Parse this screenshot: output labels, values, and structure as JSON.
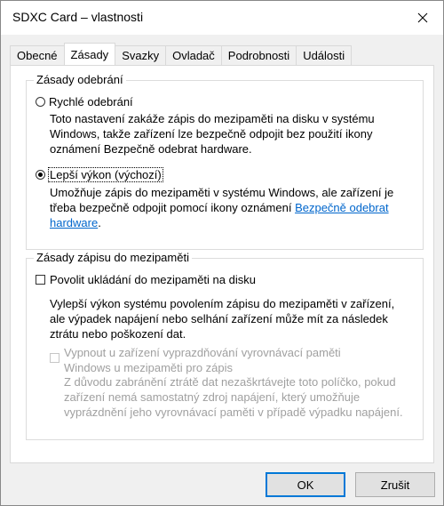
{
  "window": {
    "title": "SDXC Card – vlastnosti",
    "close_icon": "close-icon"
  },
  "tabs": [
    {
      "label": "Obecné"
    },
    {
      "label": "Zásady"
    },
    {
      "label": "Svazky"
    },
    {
      "label": "Ovladač"
    },
    {
      "label": "Podrobnosti"
    },
    {
      "label": "Události"
    }
  ],
  "active_tab": "Zásady",
  "removal_policy": {
    "legend": "Zásady odebrání",
    "quick": {
      "label": "Rychlé odebrání",
      "checked": false,
      "desc": "Toto nastavení zakáže zápis do mezipaměti na disku v systému Windows, takže zařízení lze bezpečně odpojit bez použití ikony oznámení Bezpečně odebrat hardware."
    },
    "performance": {
      "label": "Lepší výkon (výchozí)",
      "checked": true,
      "desc": "Umožňuje zápis do mezipaměti v systému Windows, ale zařízení je třeba bezpečně odpojit pomocí ikony oznámení ",
      "link": "Bezpečně odebrat hardware",
      "desc_end": "."
    }
  },
  "write_cache_policy": {
    "legend": "Zásady zápisu do mezipaměti",
    "enable_cache": {
      "label": "Povolit ukládání do mezipaměti na disku",
      "checked": false,
      "desc": "Vylepší výkon systému povolením zápisu do mezipaměti v zařízení, ale výpadek napájení nebo selhání zařízení může mít za následek ztrátu nebo poškození dat."
    },
    "disable_flush": {
      "label": "Vypnout u zařízení vyprazdňování vyrovnávací paměti Windows u mezipaměti pro zápis",
      "checked": false,
      "enabled": false,
      "desc": "Z důvodu zabránění ztrátě dat nezaškrtávejte toto políčko, pokud zařízení nemá samostatný zdroj napájení, který umožňuje vyprázdnění jeho vyrovnávací paměti v případě výpadku napájení."
    }
  },
  "buttons": {
    "ok": "OK",
    "cancel": "Zrušit"
  }
}
